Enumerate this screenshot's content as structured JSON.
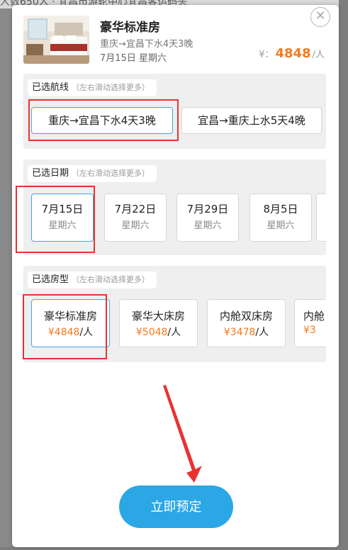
{
  "background": {
    "top_text": "人数650人 · 宜昌市游轮中心宜昌客运码头"
  },
  "product": {
    "title": "豪华标准房",
    "route": "重庆→宜昌下水4天3晚",
    "date": "7月15日 星期六",
    "price_currency": "¥：",
    "price_value": "4848",
    "price_unit": "/人"
  },
  "route_section": {
    "label": "已选航线",
    "hint": "（左右滑动选择更多）",
    "options": [
      {
        "label": "重庆→宜昌下水4天3晚",
        "selected": true
      },
      {
        "label": "宜昌→重庆上水5天4晚",
        "selected": false
      }
    ]
  },
  "date_section": {
    "label": "已选日期",
    "hint": "（左右滑动选择更多）",
    "options": [
      {
        "date": "7月15日",
        "weekday": "星期六",
        "selected": true
      },
      {
        "date": "7月22日",
        "weekday": "星期六",
        "selected": false
      },
      {
        "date": "7月29日",
        "weekday": "星期六",
        "selected": false
      },
      {
        "date": "8月5日",
        "weekday": "星期六",
        "selected": false
      }
    ]
  },
  "room_section": {
    "label": "已选房型",
    "hint": "（左右滑动选择更多）",
    "options": [
      {
        "name": "豪华标准房",
        "currency": "¥",
        "price": "4848",
        "unit": "/人",
        "selected": true
      },
      {
        "name": "豪华大床房",
        "currency": "¥",
        "price": "5048",
        "unit": "/人",
        "selected": false
      },
      {
        "name": "内舱双床房",
        "currency": "¥",
        "price": "3478",
        "unit": "/人",
        "selected": false
      },
      {
        "name": "内舱",
        "currency": "¥",
        "price": "3",
        "unit": "",
        "selected": false
      }
    ]
  },
  "book_button": {
    "label": "立即预定"
  },
  "icons": {
    "close": "close-icon"
  },
  "colors": {
    "accent": "#2ba7e6",
    "price": "#f47a20",
    "annotation": "#e83232"
  }
}
